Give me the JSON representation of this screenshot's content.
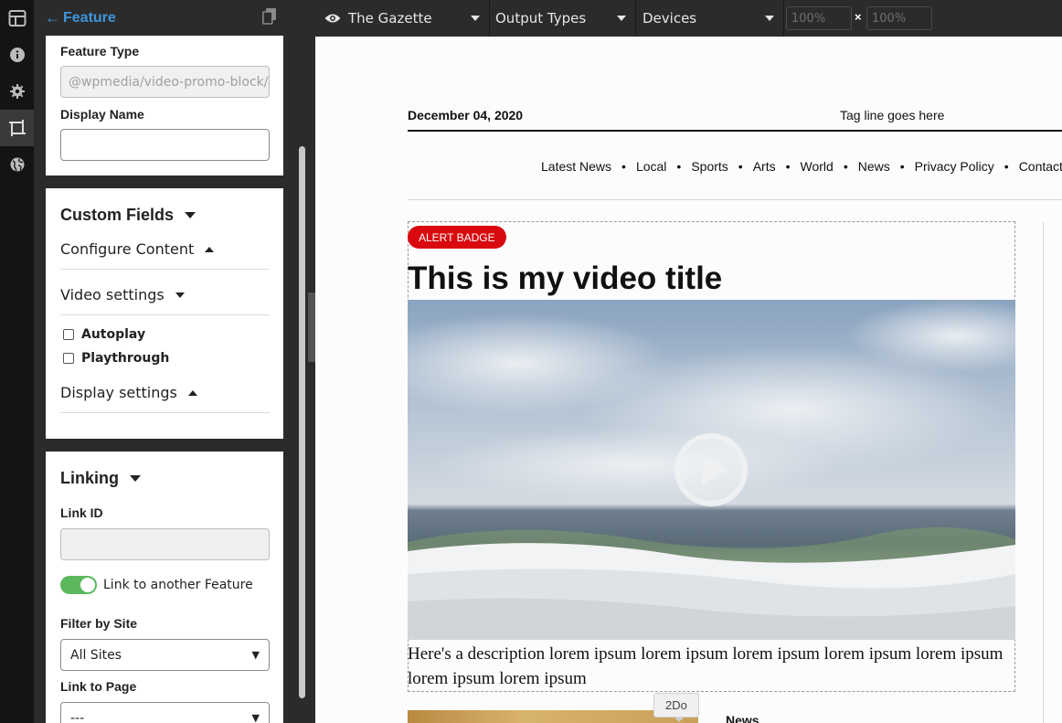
{
  "rail": {
    "items": [
      {
        "icon": "layout-icon"
      },
      {
        "icon": "info-icon"
      },
      {
        "icon": "gear-icon"
      },
      {
        "icon": "crop-frame-icon"
      },
      {
        "icon": "globe-icon"
      }
    ]
  },
  "panel": {
    "back_label": "Feature",
    "feature_type": {
      "label": "Feature Type",
      "value": "@wpmedia/video-promo-block/v"
    },
    "display_name": {
      "label": "Display Name",
      "value": ""
    },
    "custom_fields": {
      "title": "Custom Fields",
      "configure_content": "Configure Content",
      "video_settings": "Video settings",
      "autoplay": "Autoplay",
      "playthrough": "Playthrough",
      "display_settings": "Display settings"
    },
    "linking": {
      "title": "Linking",
      "link_id_label": "Link ID",
      "link_id_value": "",
      "toggle_label": "Link to another Feature",
      "filter_label": "Filter by Site",
      "filter_value": "All Sites",
      "link_page_label": "Link to Page",
      "link_page_value": "---"
    }
  },
  "toolbar": {
    "site": "The Gazette",
    "output_types": "Output Types",
    "devices": "Devices",
    "width_placeholder": "100%",
    "height_placeholder": "100%",
    "times": "×"
  },
  "preview": {
    "date": "December 04, 2020",
    "tagline": "Tag line goes here",
    "nav": [
      "Latest News",
      "Local",
      "Sports",
      "Arts",
      "World",
      "News",
      "Privacy Policy",
      "Contact"
    ],
    "nav_separator": "•",
    "badge": "ALERT BADGE",
    "headline": "This is my video title",
    "description": "Here's a description lorem ipsum lorem ipsum lorem ipsum lorem ipsum lorem ipsum lorem ipsum lorem ipsum",
    "tooltip": "2Do",
    "news_label": "News"
  },
  "colors": {
    "accent": "#3d95dc",
    "badge": "#d8090f",
    "toggle_on": "#5cb85c"
  }
}
